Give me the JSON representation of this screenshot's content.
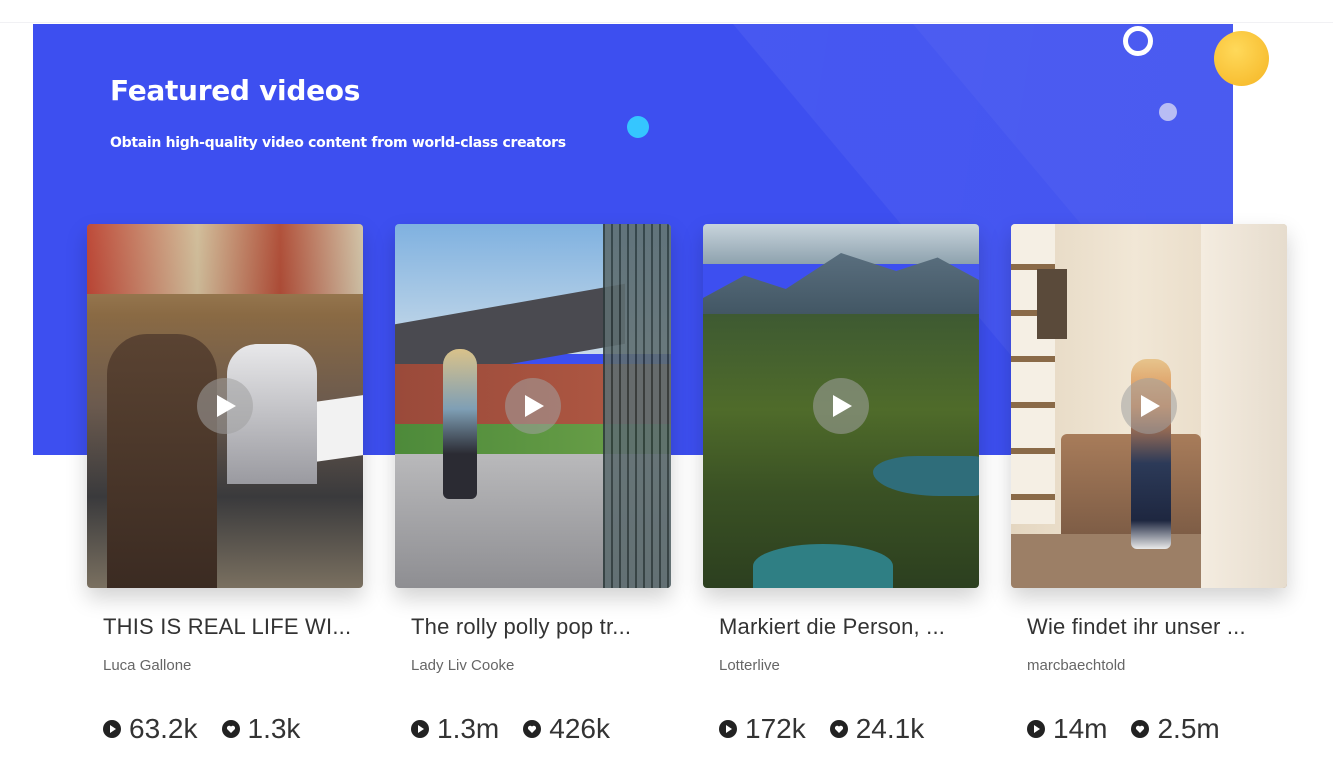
{
  "header": {
    "title": "Featured videos",
    "subtitle": "Obtain high-quality video content from world-class creators"
  },
  "colors": {
    "banner": "#3d4ff0",
    "accent_yellow": "#f5b524",
    "accent_cyan": "#35c6ff",
    "text": "#333333"
  },
  "icons": {
    "views": "play-circle-icon",
    "likes": "heart-circle-icon",
    "thumbnail_action": "play-icon"
  },
  "videos": [
    {
      "title": "THIS IS REAL LIFE WI...",
      "author": "Luca Gallone",
      "views": "63.2k",
      "likes": "1.3k"
    },
    {
      "title": "The rolly polly pop tr...",
      "author": "Lady Liv Cooke",
      "views": "1.3m",
      "likes": "426k"
    },
    {
      "title": "Markiert die Person, ...",
      "author": "Lotterlive",
      "views": "172k",
      "likes": "24.1k"
    },
    {
      "title": "Wie findet ihr unser ...",
      "author": "marcbaechtold",
      "views": "14m",
      "likes": "2.5m"
    }
  ]
}
